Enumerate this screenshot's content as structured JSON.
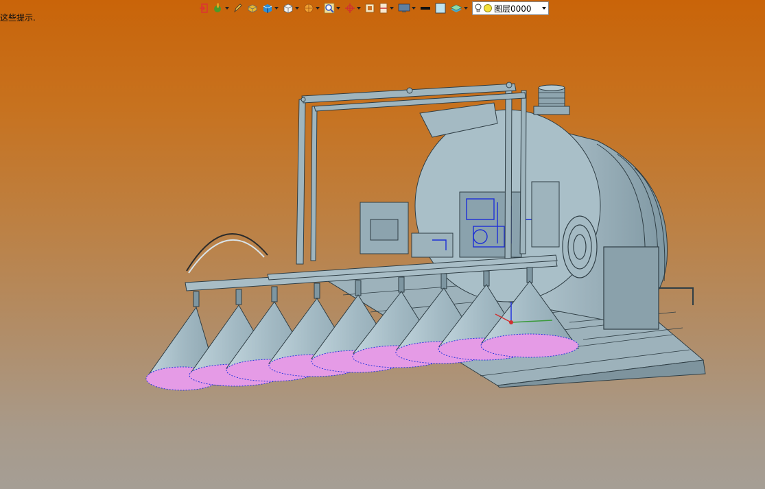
{
  "hint_text": "这些提示.",
  "layer_dropdown": {
    "label": "图层0000"
  },
  "toolbar": {
    "buttons": [
      {
        "icon": "exit-icon",
        "has_menu": false
      },
      {
        "icon": "paint-icon",
        "has_menu": true
      },
      {
        "icon": "pencil-icon",
        "has_menu": false
      },
      {
        "icon": "solid-icon",
        "has_menu": false
      },
      {
        "icon": "cube-shaded-icon",
        "has_menu": true
      },
      {
        "icon": "cube-wire-icon",
        "has_menu": true
      },
      {
        "icon": "render-icon",
        "has_menu": true
      },
      {
        "icon": "zoom-icon",
        "has_menu": true
      },
      {
        "icon": "axis-icon",
        "has_menu": true
      },
      {
        "icon": "frame-icon",
        "has_menu": false
      },
      {
        "icon": "section-icon",
        "has_menu": true
      },
      {
        "icon": "monitor-icon",
        "has_menu": true
      },
      {
        "icon": "line-icon",
        "has_menu": false
      },
      {
        "icon": "color-swatch-icon",
        "has_menu": false
      },
      {
        "icon": "layer-stack-icon",
        "has_menu": true
      }
    ]
  },
  "colors": {
    "background_top": "#c96409",
    "background_bottom": "#a59e95",
    "model_gray": "#9cb1bb",
    "cone_pink": "#e59be6",
    "highlight_blue": "#2233dd"
  }
}
